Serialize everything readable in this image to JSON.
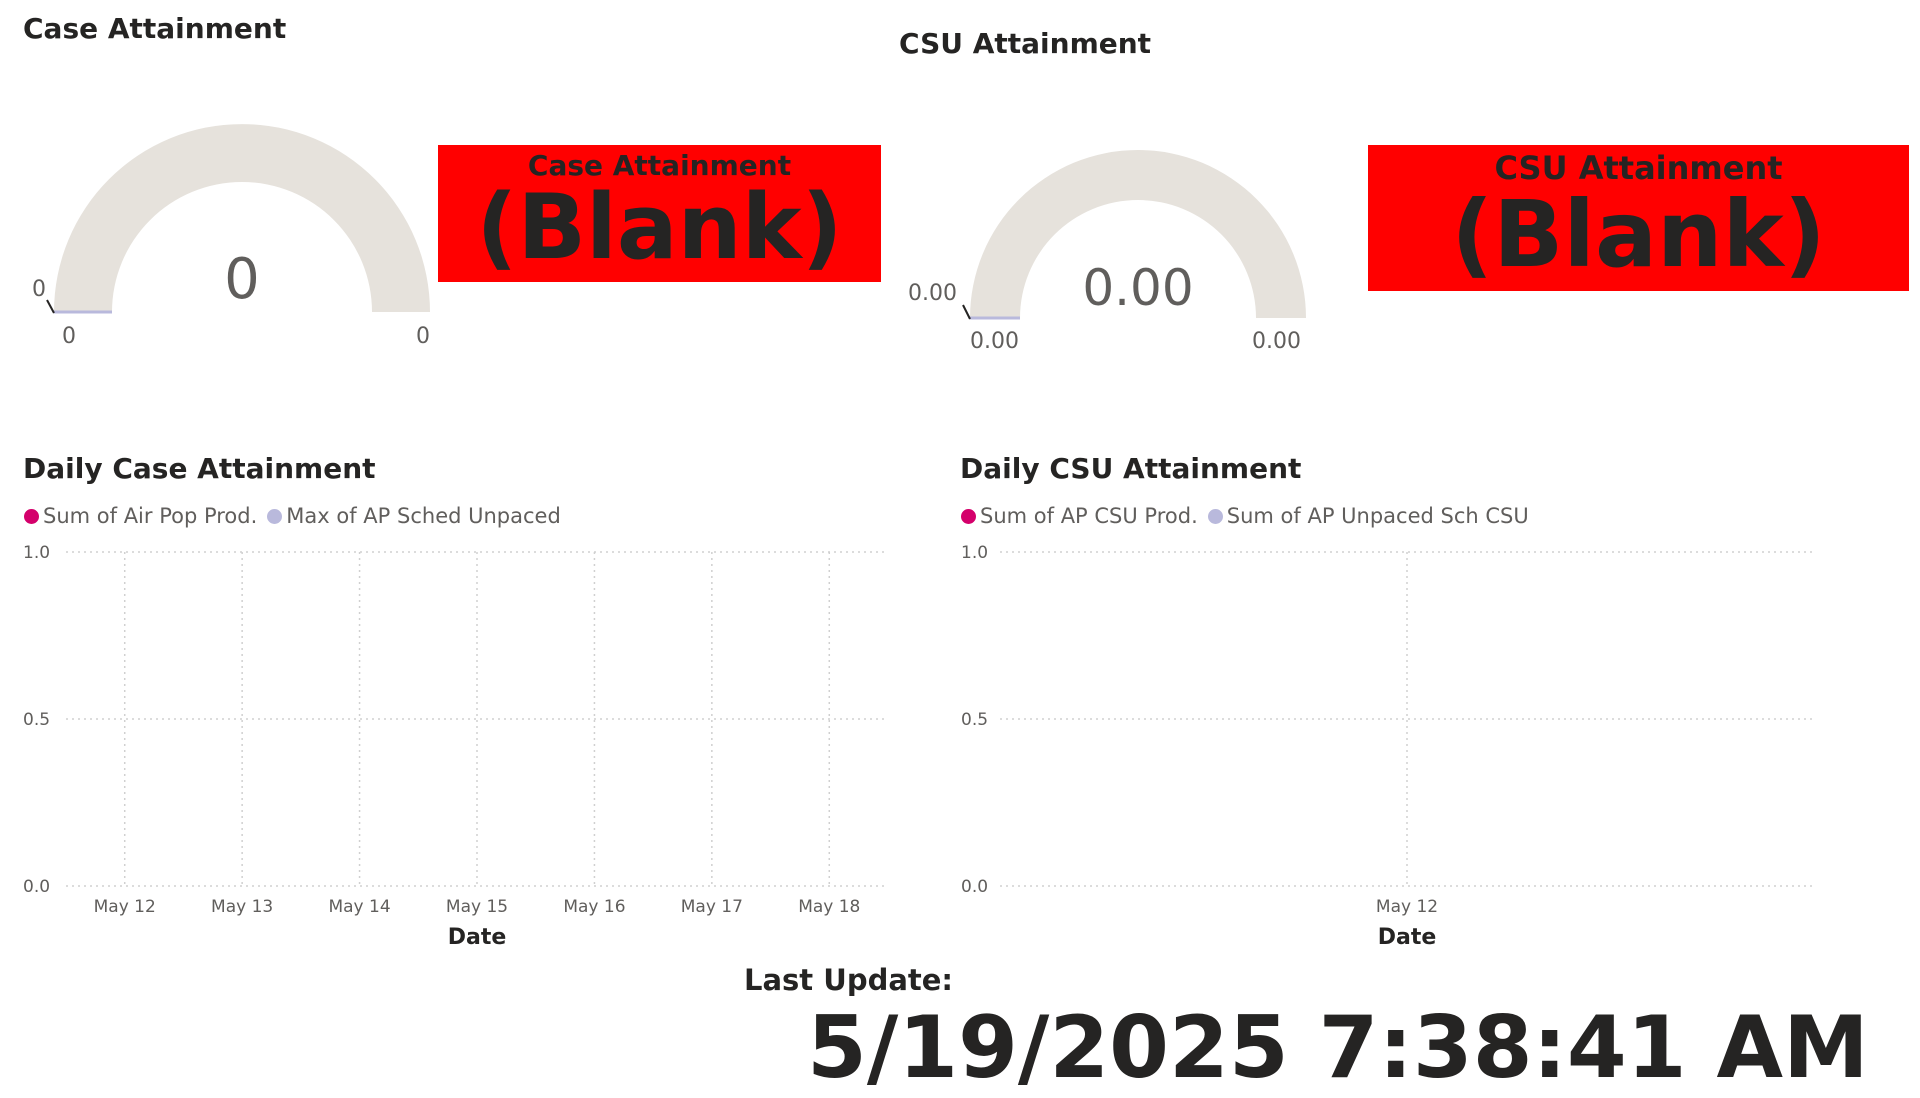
{
  "case_section": {
    "title": "Case Attainment",
    "gauge": {
      "value_label": "0",
      "min_label": "0",
      "max_label": "0",
      "target_label": "0",
      "value": 0
    },
    "card": {
      "label": "Case Attainment",
      "value": "(Blank)"
    }
  },
  "csu_section": {
    "title": "CSU Attainment",
    "gauge": {
      "value_label": "0.00",
      "min_label": "0.00",
      "max_label": "0.00",
      "target_label": "0.00",
      "value": 0
    },
    "card": {
      "label": "CSU Attainment",
      "value": "(Blank)"
    }
  },
  "colors": {
    "card_bg": "#ff0000",
    "gauge_track": "#e6e2dc",
    "series_primary": "#d4006b",
    "series_secondary": "#b9b9dc",
    "text_dark": "#252423",
    "text_muted": "#605e5c",
    "gridline": "#d0d0d0"
  },
  "last_update": {
    "label": "Last Update:",
    "value": "5/19/2025 7:38:41 AM"
  },
  "chart_data": [
    {
      "type": "line",
      "title": "Daily Case Attainment",
      "xlabel": "Date",
      "ylabel": "",
      "x": [
        "May 12",
        "May 13",
        "May 14",
        "May 15",
        "May 16",
        "May 17",
        "May 18"
      ],
      "ylim": [
        0,
        1
      ],
      "y_ticks": [
        "1.0",
        "0.5",
        "0.0"
      ],
      "grid": true,
      "legend_position": "top-left",
      "series": [
        {
          "name": "Sum of Air Pop Prod.",
          "color": "#d4006b",
          "values": []
        },
        {
          "name": "Max of AP Sched Unpaced",
          "color": "#b9b9dc",
          "values": []
        }
      ]
    },
    {
      "type": "line",
      "title": "Daily CSU Attainment",
      "xlabel": "Date",
      "ylabel": "",
      "x": [
        "May 12"
      ],
      "ylim": [
        0,
        1
      ],
      "y_ticks": [
        "1.0",
        "0.5",
        "0.0"
      ],
      "grid": true,
      "legend_position": "top-left",
      "series": [
        {
          "name": "Sum of AP CSU Prod.",
          "color": "#d4006b",
          "values": []
        },
        {
          "name": "Sum of AP Unpaced Sch CSU",
          "color": "#b9b9dc",
          "values": []
        }
      ]
    }
  ]
}
